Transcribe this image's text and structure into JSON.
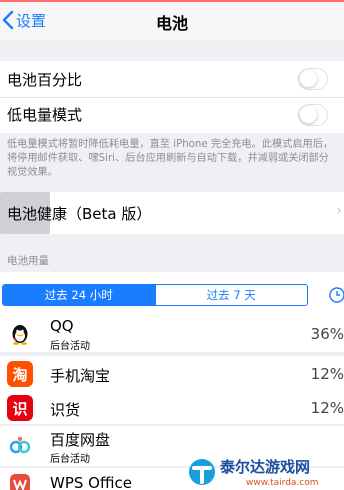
{
  "nav": {
    "back_label": "设置",
    "title": "电池"
  },
  "settings": {
    "percent_label": "电池百分比",
    "percent_on": false,
    "low_power_label": "低电量模式",
    "low_power_on": false,
    "low_power_note": "低电量模式将暂时降低耗电量，直至 iPhone 完全充电。此模式启用后，将停用邮件获取、嘿Siri、后台应用刷新与自动下载，并减弱或关闭部分视觉效果。",
    "health_label": "电池健康（Beta 版）"
  },
  "usage": {
    "section_header": "电池用量",
    "seg_24h": "过去 24 小时",
    "seg_7d": "过去 7 天",
    "apps": [
      {
        "name": "QQ",
        "sub": "后台活动",
        "pct": "36%",
        "icon": "qq-penguin",
        "color": "#ffffff"
      },
      {
        "name": "手机淘宝",
        "sub": "",
        "pct": "12%",
        "icon": "taobao",
        "color": "#ff5000",
        "glyph": "淘"
      },
      {
        "name": "识货",
        "sub": "",
        "pct": "12%",
        "icon": "shihuo",
        "color": "#e60012",
        "glyph": "识"
      },
      {
        "name": "百度网盘",
        "sub": "后台活动",
        "pct": "",
        "icon": "baidu-netdisk",
        "color": "#ffffff"
      },
      {
        "name": "WPS Office",
        "sub": "",
        "pct": "",
        "icon": "wps",
        "color": "#ffffff"
      }
    ]
  },
  "watermark": {
    "brand": "泰尔达游戏网",
    "url": "www.tairda.com"
  },
  "colors": {
    "accent": "#1a7cff",
    "background": "#efeff4",
    "secondary_text": "#8e8e93"
  }
}
